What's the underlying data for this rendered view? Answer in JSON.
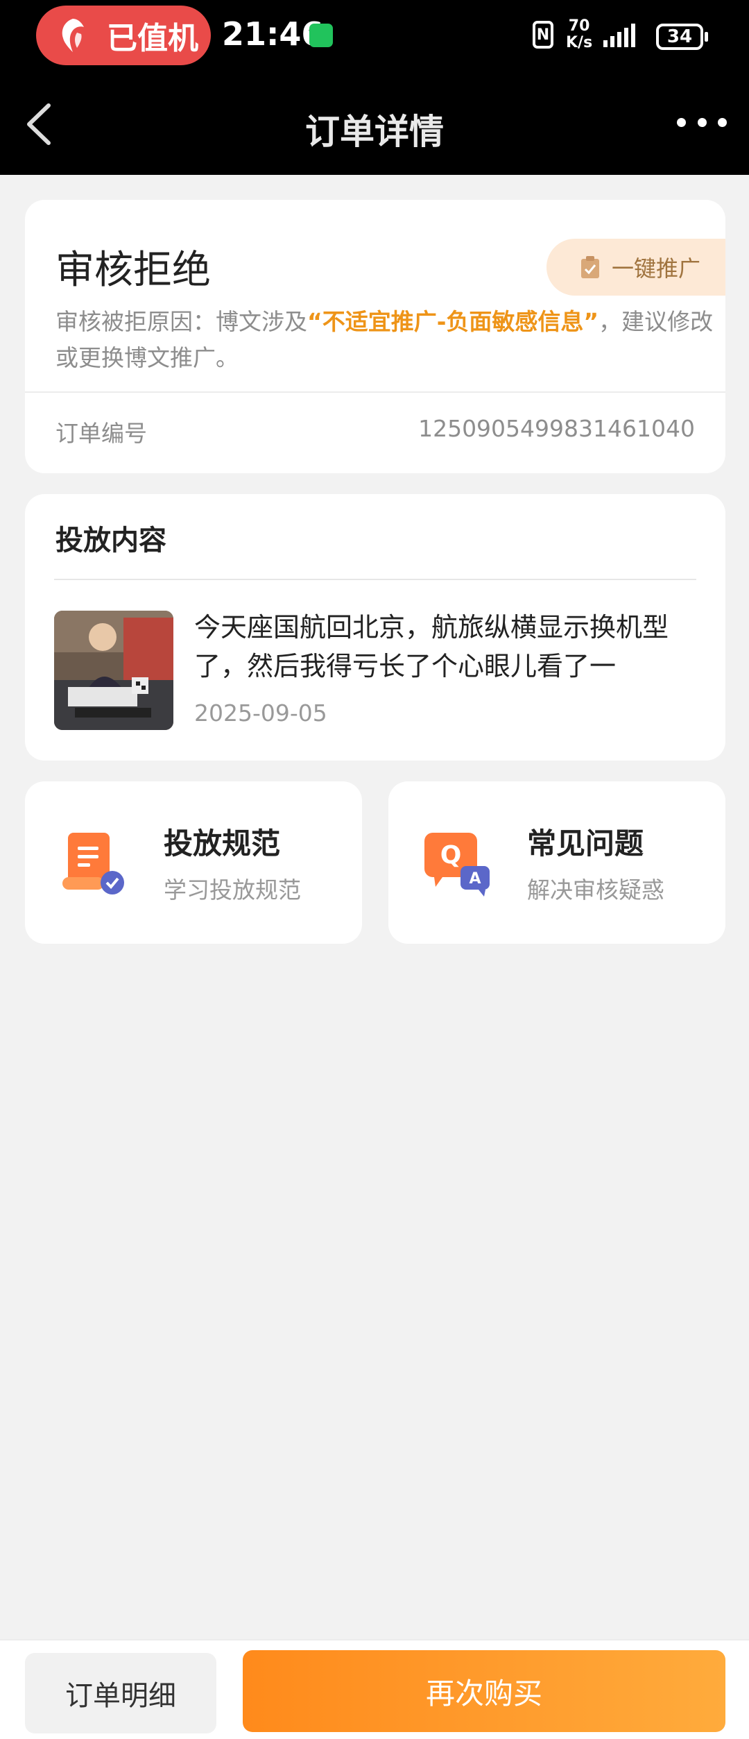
{
  "status_bar": {
    "airline_label": "已值机",
    "time": "21:46",
    "network_speed_value": "70",
    "network_speed_unit": "K/s",
    "nfc": "N",
    "battery": "34"
  },
  "nav": {
    "title": "订单详情"
  },
  "order": {
    "status_title": "审核拒绝",
    "promote_button": "一键推广",
    "reason_prefix": "审核被拒原因：博文涉及",
    "reason_highlight": "“不适宜推广-负面敏感信息”",
    "reason_suffix": "，建议修改或更换博文推广。",
    "order_number_label": "订单编号",
    "order_number": "1250905499831461040"
  },
  "content": {
    "section_title": "投放内容",
    "post_text": "今天座国航回北京，航旅纵横显示换机型了，然后我得亏长了个心眼儿看了一",
    "post_date": "2025-09-05"
  },
  "quick_links": [
    {
      "title": "投放规范",
      "subtitle": "学习投放规范",
      "icon": "document-check-icon"
    },
    {
      "title": "常见问题",
      "subtitle": "解决审核疑惑",
      "icon": "qa-bubble-icon"
    }
  ],
  "bottom": {
    "detail_button": "订单明细",
    "buy_button": "再次购买"
  },
  "colors": {
    "accent_orange": "#ff8a1b",
    "highlight_text": "#ee9418",
    "pill_red": "#e94b49",
    "promote_bg": "#fde9d6"
  }
}
